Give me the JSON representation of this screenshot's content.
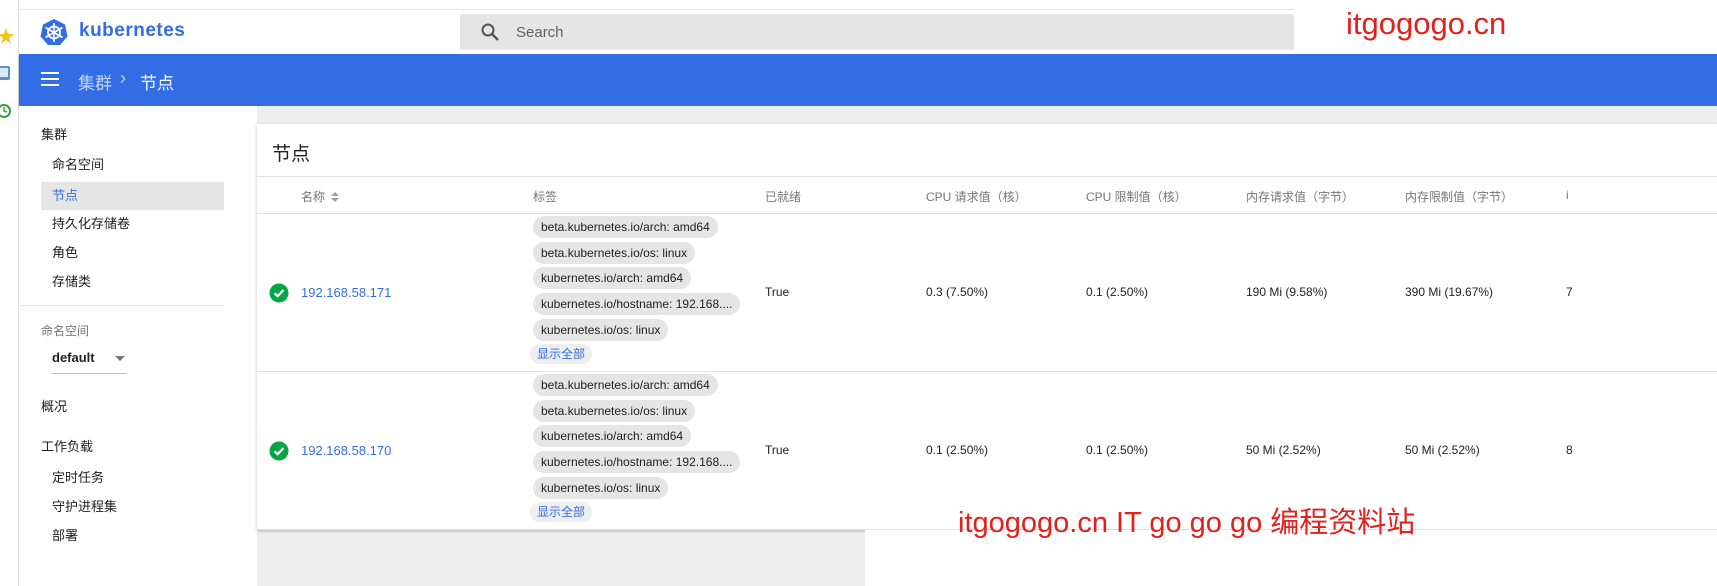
{
  "header": {
    "brand": "kubernetes",
    "search_placeholder": "Search",
    "watermark": "itgogogo.cn"
  },
  "breadcrumb": {
    "parent": "集群",
    "separator": "›",
    "current": "节点"
  },
  "sidebar": {
    "cluster_title": "集群",
    "cluster_items": [
      "命名空间",
      "节点",
      "持久化存储卷",
      "角色",
      "存储类"
    ],
    "active_item": "节点",
    "namespace_label": "命名空间",
    "namespace_value": "default",
    "overview": "概况",
    "workloads_title": "工作负载",
    "workload_items": [
      "定时任务",
      "守护进程集",
      "部署"
    ]
  },
  "card": {
    "title": "节点",
    "columns": {
      "name": "名称",
      "labels": "标签",
      "ready": "已就绪",
      "cpu_request": "CPU 请求值（核）",
      "cpu_limit": "CPU 限制值（核）",
      "mem_request": "内存请求值（字节）",
      "mem_limit": "内存限制值（字节）",
      "extra": "i"
    },
    "rows": [
      {
        "name": "192.168.58.171",
        "labels": [
          "beta.kubernetes.io/arch: amd64",
          "beta.kubernetes.io/os: linux",
          "kubernetes.io/arch: amd64",
          "kubernetes.io/hostname: 192.168....",
          "kubernetes.io/os: linux"
        ],
        "show_all": "显示全部",
        "ready": "True",
        "cpu_request": "0.3 (7.50%)",
        "cpu_limit": "0.1 (2.50%)",
        "mem_request": "190 Mi (9.58%)",
        "mem_limit": "390 Mi (19.67%)",
        "extra": "7"
      },
      {
        "name": "192.168.58.170",
        "labels": [
          "beta.kubernetes.io/arch: amd64",
          "beta.kubernetes.io/os: linux",
          "kubernetes.io/arch: amd64",
          "kubernetes.io/hostname: 192.168....",
          "kubernetes.io/os: linux"
        ],
        "show_all": "显示全部",
        "ready": "True",
        "cpu_request": "0.1 (2.50%)",
        "cpu_limit": "0.1 (2.50%)",
        "mem_request": "50 Mi (2.52%)",
        "mem_limit": "50 Mi (2.52%)",
        "extra": "8"
      }
    ]
  },
  "watermark_bottom": "itgogogo.cn IT go go go 编程资料站",
  "colors": {
    "primary": "#326de6",
    "success": "#00a845",
    "watermark": "#e3201b"
  }
}
